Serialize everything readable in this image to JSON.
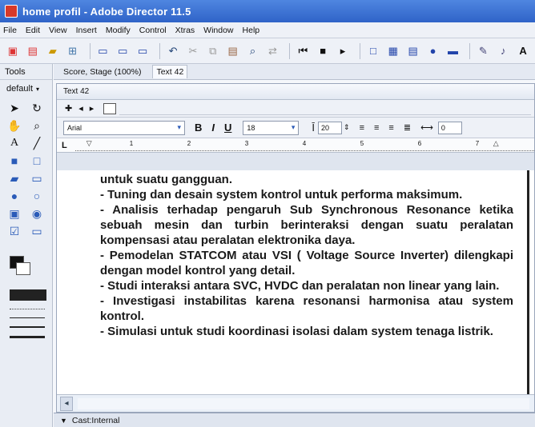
{
  "window": {
    "title": "home profil - Adobe Director 11.5"
  },
  "menubar": {
    "items": [
      "File",
      "Edit",
      "View",
      "Insert",
      "Modify",
      "Control",
      "Xtras",
      "Window",
      "Help"
    ]
  },
  "tools": {
    "header": "Tools",
    "preset": "default"
  },
  "tabs": [
    {
      "label": "Score, Stage (100%)"
    },
    {
      "label": "Text 42"
    }
  ],
  "text_window": {
    "title": "Text 42",
    "font": "Arial",
    "size": "18",
    "spacing": "20",
    "kerning": "0",
    "bold_label": "B",
    "italic_label": "I",
    "underline_label": "U",
    "ruler_left": "L",
    "ruler_numbers": [
      "1",
      "2",
      "3",
      "4",
      "5",
      "6",
      "7"
    ],
    "content": "untuk suatu gangguan.\n- Tuning dan desain system kontrol untuk performa maksimum.\n- Analisis terhadap pengaruh Sub Synchronous Resonance ketika sebuah mesin dan turbin berinteraksi dengan suatu peralatan kompensasi atau peralatan elektronika daya.\n- Pemodelan STATCOM atau VSI ( Voltage Source Inverter) dilengkapi dengan model kontrol yang detail.\n- Studi interaksi antara SVC, HVDC dan peralatan non linear yang lain.\n- Investigasi instabilitas karena resonansi harmonisa atau system kontrol.\n- Simulasi untuk studi koordinasi isolasi dalam system tenaga listrik."
  },
  "castbar": {
    "label": "Cast:Internal"
  },
  "colors": {
    "titlebar": "#2f63c8",
    "panel": "#e9edf4",
    "text": "#1a1a1a"
  }
}
